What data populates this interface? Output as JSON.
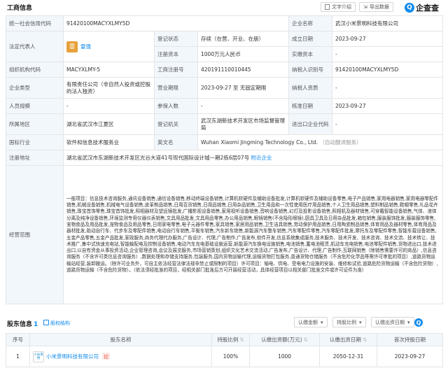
{
  "header": {
    "title": "工商信息",
    "sub": "",
    "btn_intro": "文字介绍",
    "btn_export": "导出数据",
    "logo": "企查查"
  },
  "rows": {
    "credit_code_label": "统一社会信用代码",
    "credit_code": "91420100MACYXLMY5D",
    "company_name_label": "企业名称",
    "company_name": "武汉小米景明科技有限公司",
    "legal_rep_label": "法定代表人",
    "legal_rep_avatar": "雷",
    "legal_rep": "雷强",
    "reg_status_label": "登记状态",
    "reg_status": "存续（在营、开业、在册）",
    "est_date_label": "成立日期",
    "est_date": "2023-09-27",
    "reg_capital_label": "注册资本",
    "reg_capital": "1000万元人民币",
    "paid_capital_label": "实缴资本",
    "paid_capital": "-",
    "org_code_label": "组织机构代码",
    "org_code": "MACYXLMY-5",
    "biz_reg_no_label": "工商注册号",
    "biz_reg_no": "420191110010445",
    "taxpayer_id_label": "纳税人识别号",
    "taxpayer_id": "91420100MACYXLMY5D",
    "type_label": "企业类型",
    "type": "有限责任公司（非自然人投资或控股的法人独资）",
    "term_label": "营业期限",
    "term": "2023-09-27 至 无固定期限",
    "qualification_label": "纳税人资质",
    "qualification": "-",
    "staff_label": "人员规模",
    "staff": "-",
    "insured_label": "参保人数",
    "insured": "-",
    "approve_label": "核准日期",
    "approve": "2023-09-27",
    "region_label": "所属地区",
    "region": "湖北省武汉市江夏区",
    "authority_label": "登记机关",
    "authority": "武汉东湖新技术开发区市场监督管理局",
    "import_export_label": "进出口企业代码",
    "import_export": "-",
    "industry_label": "国标行业",
    "industry": "软件和信息技术服务业",
    "en_name_label": "英文名",
    "en_name": "Wuhan Xiaomi Jingming Technology Co., Ltd.",
    "en_name_note": "（自动翻译服务）",
    "address_label": "注册地址",
    "address": "湖北省武汉市东湖新技术开发区光谷大道41号现代国际设计城一期2栋6层07号",
    "address_link": "附近企业",
    "scope_label": "经营范围",
    "scope": "一般项目：信息技术咨询服务,通讯设备销售,通信设备销售,移动终端设备销售,计算机软硬件及辅助设备批发,计算机软硬件及辅助设备零售,电子产品销售,家用电器销售,家用电器零配件销售,机械设备销售,机械电气设备销售,皮革制品销售,日用百货销售,日用品销售,日用杂品销售,卫生用品和一次性使用医疗用品销售,个人卫生用品销售,塑料制品销售,鞋帽零售,礼品花卉销售,珠宝首饰零售,珠宝首饰批发,照相器材及望远镜批发,广播影视设备销售,家用视听设备销售,音响设备销售,幻灯及投影设备销售,照相机及器材销售,可穿戴智能设备销售,气体、液体分离及纯净设备销售,环境监测专用仪器仪表销售,文具用品批发,文具用品零售,办公用品销售,眼镜销售(不含隐形眼镜),厨具卫具及日用杂品批发,箱包销售,服装服饰批发,服装服饰零售,宠物食品及用品批发,宠物食品及用品零售,日用家电零售,电子元器件零售,家具销售,家居用品销售,卫生洁具销售,劳动保护用品销售,日用陶瓷制品销售,体育用品及器材零售,体育用品及器材批发,助动自行车、代步车及零配件销售,电动自行车销售,平衡车销售,汽车新车销售,新能源汽车整车销售,汽车零配件零售,汽车零配件批发,摩托车及零配件零售,智能车载设备销售,五金产品零售,五金产品批发,家政服务,商务代理代办服务,广告设计、代理,广告制作,广告发布,软件开发,信息系统集成服务,技术服务、技术开发、技术咨询、技术交流、技术转让、技术推广,集中式快速充电站,智能输配电及控制设备销售,电动汽车充电基础设施运营,新能源汽车换电设施销售,电池销售,蓄电池租赁,机动车充电销售,电池零配件销售,货物进出口,技术进出口,以自有资金从事投资活动,企业管理咨询,会议及展览服务,市场营销策划,组织文化艺术交流活动,广告发布,广告设计、代理,广告制作,互联网销售（除销售需要许可的商品）,信息咨询服务（不含许可类信息咨询服务）,数据处理和存储支持服务,包装服务,国内货物运输代理,运输货物打包服务,普通货物仓储服务（不含危险化学品等需许可审批的项目）,道路货物运输站经营,装卸搬运。（除许可业务外，可自主依法经营法律法规非禁止或限制的项目）许可项目：输电、供电、受电电力设施的安装、维修和试验,道路危险货物运输（不含危险货物）,道路货物运输（不含危险货物）。（依法须经批准的项目，经相关部门批准后方可开展经营活动，具体经营项目以相关部门批准文件或许可证件为准）"
  },
  "shareholders": {
    "title": "股东信息",
    "count": "1",
    "tag": "股权结构",
    "dd1": "认缴金额",
    "dd2": "持股比例",
    "dd3": "认缴出资日期",
    "logo": "企查查",
    "columns": [
      "序号",
      "股东名称",
      "持股比例",
      "认缴出资额(万元)",
      "认缴出资日期",
      "首次持股日期"
    ],
    "row": {
      "index": "1",
      "logo_text": "小米景明",
      "name": "小米景明科技有限公司",
      "badge": "控",
      "ratio": "100%",
      "amount": "1000",
      "date": "2050-12-31",
      "first": "2023-09-27"
    }
  }
}
